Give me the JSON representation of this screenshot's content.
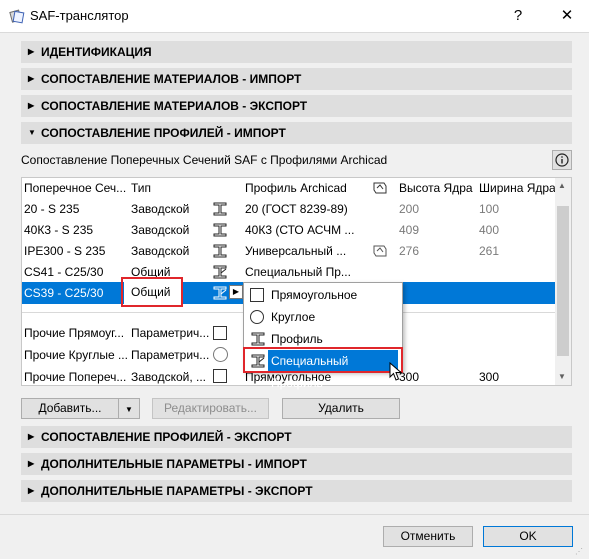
{
  "window": {
    "title": "SAF-транслятор",
    "help": "?",
    "close": "✕"
  },
  "sections": {
    "identification": "ИДЕНТИФИКАЦИЯ",
    "materials_import": "СОПОСТАВЛЕНИЕ МАТЕРИАЛОВ - ИМПОРТ",
    "materials_export": "СОПОСТАВЛЕНИЕ МАТЕРИАЛОВ - ЭКСПОРТ",
    "profiles_import": "СОПОСТАВЛЕНИЕ ПРОФИЛЕЙ - ИМПОРТ",
    "profiles_export": "СОПОСТАВЛЕНИЕ ПРОФИЛЕЙ - ЭКСПОРТ",
    "extra_import": "ДОПОЛНИТЕЛЬНЫЕ ПАРАМЕТРЫ - ИМПОРТ",
    "extra_export": "ДОПОЛНИТЕЛЬНЫЕ ПАРАМЕТРЫ - ЭКСПОРТ"
  },
  "mapping": {
    "subtitle": "Сопоставление Поперечных Сечений SAF с Профилями Archicad",
    "info": "i",
    "headers": {
      "cross_section": "Поперечное Сеч...",
      "type": "Тип",
      "profile": "Профиль Archicad",
      "core_height": "Высота Ядра",
      "core_width": "Ширина Ядра"
    },
    "rows": [
      {
        "section": "20 - S 235",
        "type": "Заводской",
        "profile": "20 (ГОСТ 8239-89)",
        "height": "200",
        "width": "100"
      },
      {
        "section": "40К3 - S 235",
        "type": "Заводской",
        "profile": "40К3 (СТО АСЧМ ...",
        "height": "409",
        "width": "400"
      },
      {
        "section": "IPE300 - S 235",
        "type": "Заводской",
        "profile": "Универсальный ...",
        "height": "276",
        "width": "261"
      },
      {
        "section": "CS41 - C25/30",
        "type": "Общий",
        "profile": "Специальный Пр...",
        "height": "",
        "width": ""
      },
      {
        "section": "CS39 - C25/30",
        "type": "Общий",
        "profile": "",
        "height": "",
        "width": ""
      }
    ],
    "other_rows": [
      {
        "section": "Прочие Прямоуг...",
        "type": "Параметрич..."
      },
      {
        "section": "Прочие Круглые ...",
        "type": "Параметрич..."
      },
      {
        "section": "Прочие Попереч...",
        "type": "Заводской, ...",
        "profile": "Прямоугольное",
        "height": "300",
        "width": "300"
      }
    ]
  },
  "dropdown": {
    "items": [
      "Прямоугольное",
      "Круглое",
      "Профиль",
      "Специальный Профиль"
    ],
    "selected_index": 3
  },
  "buttons": {
    "add": "Добавить...",
    "edit": "Редактировать...",
    "delete": "Удалить",
    "cancel": "Отменить",
    "ok": "OK"
  },
  "colors": {
    "selection": "#0078d7",
    "highlight_box": "#e0262b"
  }
}
